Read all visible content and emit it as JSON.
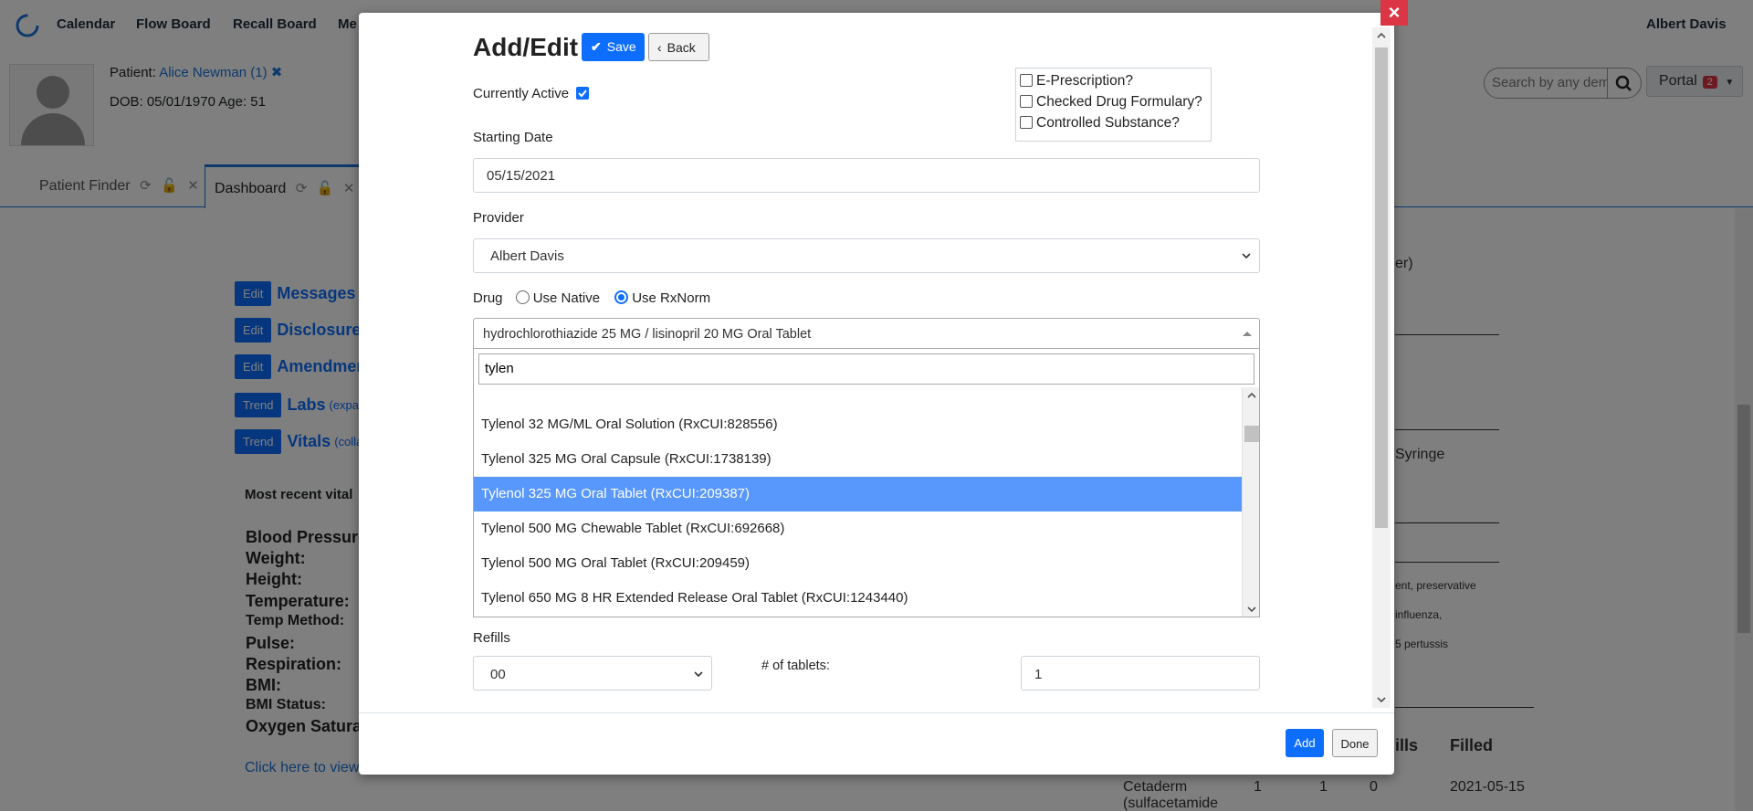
{
  "app": {
    "nav": [
      "Calendar",
      "Flow Board",
      "Recall Board",
      "Me"
    ],
    "user": "Albert Davis"
  },
  "patient": {
    "label": "Patient:",
    "name": "Alice Newman (1)",
    "dob_line": "DOB: 05/01/1970 Age: 51"
  },
  "header": {
    "search_placeholder": "Search by any dem",
    "portal_label": "Portal",
    "portal_count": "2"
  },
  "tabs": [
    {
      "label": "Patient Finder"
    },
    {
      "label": "Dashboard"
    }
  ],
  "dashboard": {
    "sections": [
      {
        "button": "Edit",
        "title": "Messages",
        "sub": ""
      },
      {
        "button": "Edit",
        "title": "Disclosures",
        "sub": ""
      },
      {
        "button": "Edit",
        "title": "Amendments",
        "sub": ""
      },
      {
        "button": "Trend",
        "title": "Labs",
        "sub": "(expa"
      },
      {
        "button": "Trend",
        "title": "Vitals",
        "sub": "(colla"
      }
    ],
    "vitals_heading": "Most recent vital",
    "vitals_labels": [
      "Blood Pressure",
      "Weight:",
      "Height:",
      "Temperature:",
      "Temp Method:",
      "Pulse:",
      "Respiration:",
      "BMI:",
      "BMI Status:",
      "Oxygen Satura"
    ],
    "vitals_link": "Click here to view",
    "right_snippets": {
      "er": "er)",
      "syringe": "Syringe",
      "preservative": "ent, preservative",
      "influenza": "influenza,",
      "pertussis": "5 pertussis"
    },
    "rx_table": {
      "headers": [
        "ills",
        "Filled"
      ],
      "row": {
        "drug": "Cetaderm",
        "drug2": "(sulfacetamide",
        "c1": "1",
        "c2": "1",
        "c3": "0",
        "filled": "2021-05-15"
      }
    }
  },
  "modal": {
    "title": "Add/Edit",
    "save_label": "Save",
    "back_label": "Back",
    "currently_active_label": "Currently Active",
    "currently_active_checked": true,
    "options": [
      {
        "label": "E-Prescription?",
        "checked": false
      },
      {
        "label": "Checked Drug Formulary?",
        "checked": false
      },
      {
        "label": "Controlled Substance?",
        "checked": false
      }
    ],
    "starting_date_label": "Starting Date",
    "starting_date_value": "05/15/2021",
    "provider_label": "Provider",
    "provider_value": "Albert Davis",
    "drug_label": "Drug",
    "drug_modes": [
      {
        "label": "Use Native",
        "checked": false
      },
      {
        "label": "Use RxNorm",
        "checked": true
      }
    ],
    "drug_value": "hydrochlorothiazide 25 MG / lisinopril 20 MG Oral Tablet",
    "drug_search_value": "tylen",
    "drug_results": [
      {
        "label": "Tylenol 32 MG/ML Oral Solution (RxCUI:828556)",
        "selected": false
      },
      {
        "label": "Tylenol 325 MG Oral Capsule (RxCUI:1738139)",
        "selected": false
      },
      {
        "label": "Tylenol 325 MG Oral Tablet (RxCUI:209387)",
        "selected": true
      },
      {
        "label": "Tylenol 500 MG Chewable Tablet (RxCUI:692668)",
        "selected": false
      },
      {
        "label": "Tylenol 500 MG Oral Tablet (RxCUI:209459)",
        "selected": false
      },
      {
        "label": "Tylenol 650 MG 8 HR Extended Release Oral Tablet (RxCUI:1243440)",
        "selected": false
      }
    ],
    "refills_label": "Refills",
    "refills_value": "00",
    "tablets_label": "# of tablets:",
    "tablets_value": "1",
    "add_label": "Add",
    "done_label": "Done",
    "close_symbol": "×"
  },
  "colors": {
    "primary": "#0d6efd",
    "selected_option": "#5897fb",
    "close": "#dc3545"
  }
}
